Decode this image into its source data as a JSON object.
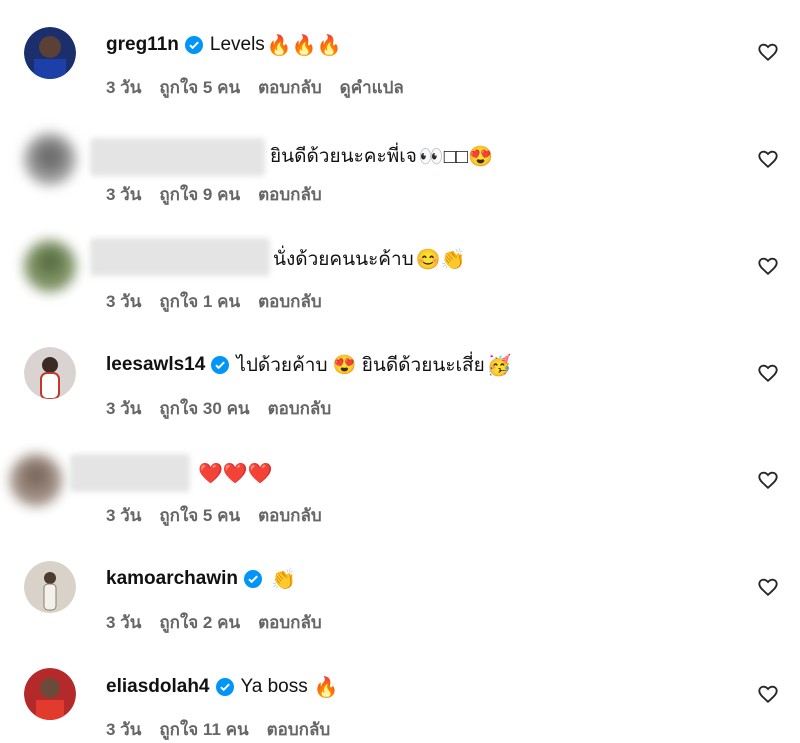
{
  "comments": [
    {
      "username": "greg11n",
      "verified": true,
      "text": "Levels",
      "emoji": "🔥🔥🔥",
      "time": "3 วัน",
      "likes": "ถูกใจ 5 คน",
      "reply": "ตอบกลับ",
      "translate": "ดูคำแปล"
    },
    {
      "username": "",
      "verified": false,
      "text": "ยินดีด้วยนะคะพี่เจ",
      "emoji": "👀□□😍",
      "time": "3 วัน",
      "likes": "ถูกใจ 9 คน",
      "reply": "ตอบกลับ"
    },
    {
      "username": "",
      "verified": false,
      "text": "นั่งด้วยคนนะค้าบ",
      "emoji": "😊👏",
      "time": "3 วัน",
      "likes": "ถูกใจ 1 คน",
      "reply": "ตอบกลับ"
    },
    {
      "username": "leesawls14",
      "verified": true,
      "text": "ไปด้วยค้าบ 😍 ยินดีด้วยนะเสี่ย",
      "emoji": "🥳",
      "time": "3 วัน",
      "likes": "ถูกใจ 30 คน",
      "reply": "ตอบกลับ"
    },
    {
      "username": "",
      "verified": false,
      "text": "",
      "emoji": "❤️❤️❤️",
      "time": "3 วัน",
      "likes": "ถูกใจ 5 คน",
      "reply": "ตอบกลับ"
    },
    {
      "username": "kamoarchawin",
      "verified": true,
      "text": "",
      "emoji": "👏",
      "time": "3 วัน",
      "likes": "ถูกใจ 2 คน",
      "reply": "ตอบกลับ"
    },
    {
      "username": "eliasdolah4",
      "verified": true,
      "text": "Ya boss",
      "emoji": "🔥",
      "time": "3 วัน",
      "likes": "ถูกใจ 11 คน",
      "reply": "ตอบกลับ"
    }
  ],
  "colors": {
    "verified": "#0095f6",
    "meta": "#666666"
  },
  "icons": {
    "like": "heart-outline-icon",
    "verified": "verified-badge-icon"
  }
}
